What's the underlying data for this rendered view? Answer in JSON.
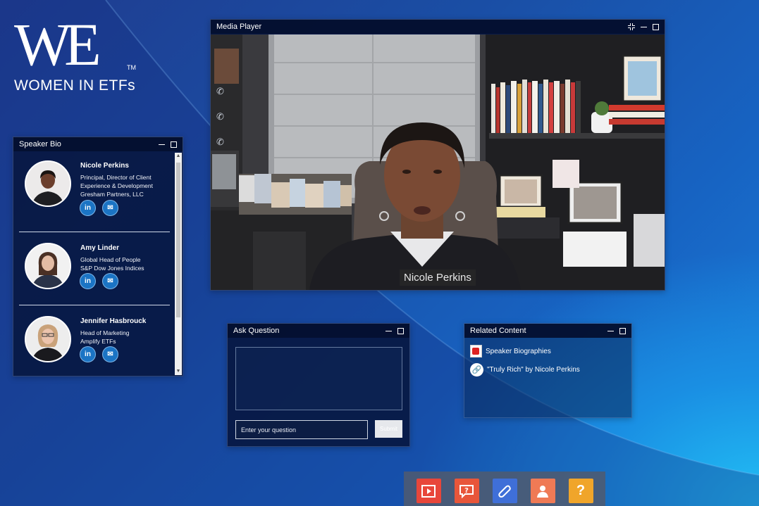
{
  "brand": {
    "logo_mark": "WE",
    "trademark": "TM",
    "tagline": "WOMEN IN ETFs"
  },
  "media_player": {
    "title": "Media Player",
    "caption": "Nicole Perkins",
    "side_icons": [
      "phone-icon",
      "phone-icon",
      "phone-icon"
    ]
  },
  "speaker_bio": {
    "title": "Speaker Bio",
    "speakers": [
      {
        "name": "Nicole Perkins",
        "lines": [
          "Principal, Director of Client",
          "Experience & Development",
          "Gresham Partners, LLC"
        ]
      },
      {
        "name": "Amy Linder",
        "lines": [
          "Global Head of People",
          "S&P Dow Jones Indices"
        ]
      },
      {
        "name": "Jennifer Hasbrouck",
        "lines": [
          "Head of Marketing",
          "Amplify ETFs"
        ]
      }
    ],
    "linkedin_label": "in",
    "email_icon": "envelope-icon"
  },
  "ask_question": {
    "title": "Ask Question",
    "input_placeholder": "Enter your question",
    "submit_label": "Submit"
  },
  "related_content": {
    "title": "Related Content",
    "items": [
      {
        "label": "Speaker Biographies",
        "icon": "pdf-icon"
      },
      {
        "label": "\"Truly Rich\" by Nicole Perkins",
        "icon": "link-icon"
      }
    ]
  },
  "dock": {
    "buttons": [
      {
        "name": "media-player",
        "icon": "play-icon",
        "color": "#e8463a"
      },
      {
        "name": "ask-question",
        "icon": "question-bubble-icon",
        "color": "#e8563a"
      },
      {
        "name": "related-content",
        "icon": "paperclip-icon",
        "color": "#3f6fd8"
      },
      {
        "name": "speaker-bio",
        "icon": "person-icon",
        "color": "#ef7a55"
      },
      {
        "name": "help",
        "icon": "question-icon",
        "color": "#f0a52a",
        "glyph": "?"
      }
    ]
  }
}
